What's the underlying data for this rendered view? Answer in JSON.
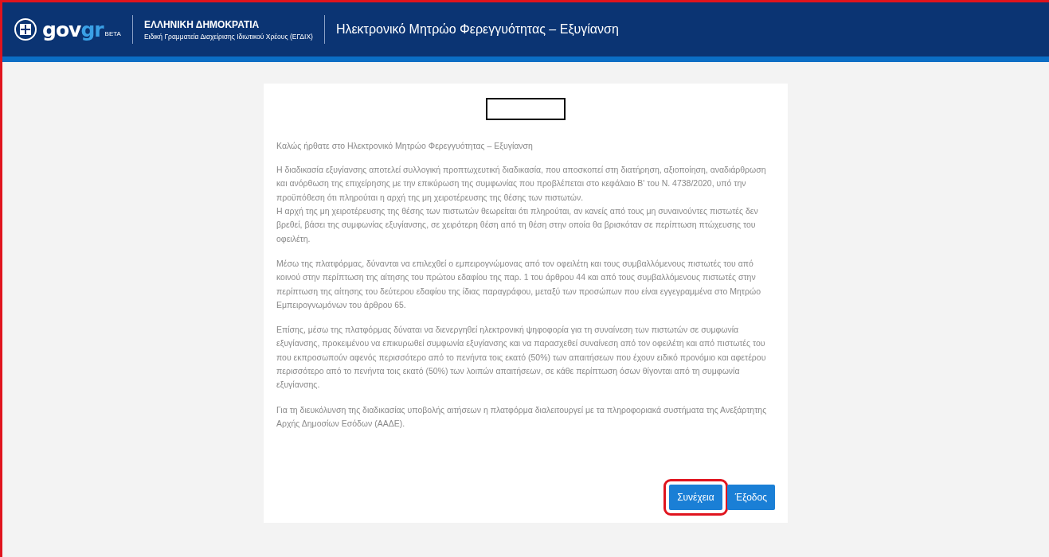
{
  "header": {
    "logo": {
      "gov": "gov",
      "gr": "gr",
      "badge": "BETA"
    },
    "organization": {
      "title": "ΕΛΛΗΝΙΚΗ ΔΗΜΟΚΡΑΤΙΑ",
      "subtitle": "Ειδική Γραμματεία Διαχείρισης Ιδιωτικού Χρέους (ΕΓΔΙΧ)"
    },
    "service_title": "Ηλεκτρονικό Μητρώο Φερεγγυότητας – Εξυγίανση"
  },
  "card": {
    "welcome": "Καλώς ήρθατε στο Ηλεκτρονικό Μητρώο Φερεγγυότητας – Εξυγίανση",
    "paragraphs": [
      {
        "lines": [
          "Η διαδικασία εξυγίανσης αποτελεί συλλογική προπτωχευτική διαδικασία, που αποσκοπεί στη διατήρηση, αξιοποίηση, αναδιάρθρωση και ανόρθωση της επιχείρησης με την επικύρωση της συμφωνίας που προβλέπεται στο κεφάλαιο Β' του Ν. 4738/2020, υπό την προϋπόθεση ότι πληρούται η αρχή της μη χειροτέρευσης της θέσης των πιστωτών.",
          "Η αρχή της μη χειροτέρευσης της θέσης των πιστωτών θεωρείται ότι πληρούται, αν κανείς από τους μη συναινούντες πιστωτές δεν βρεθεί, βάσει της συμφωνίας εξυγίανσης, σε χειρότερη θέση από τη θέση στην οποία θα βρισκόταν σε περίπτωση πτώχευσης του οφειλέτη."
        ]
      },
      {
        "lines": [
          "Μέσω της πλατφόρμας, δύνανται να επιλεχθεί ο εμπειρογνώμονας από τον οφειλέτη και τους συμβαλλόμενους πιστωτές του από κοινού στην περίπτωση της αίτησης του πρώτου εδαφίου της παρ. 1 του άρθρου 44 και από τους συμβαλλόμενους πιστωτές στην περίπτωση της αίτησης του δεύτερου εδαφίου της ίδιας παραγράφου, μεταξύ των προσώπων που είναι εγγεγραμμένα στο Μητρώο Εμπειρογνωμόνων του άρθρου 65."
        ]
      },
      {
        "lines": [
          "Επίσης, μέσω της πλατφόρμας δύναται να διενεργηθεί ηλεκτρονική ψηφοφορία για τη συναίνεση των πιστωτών σε συμφωνία εξυγίανσης, προκειμένου να επικυρωθεί συμφωνία εξυγίανσης και να παρασχεθεί συναίνεση από τον οφειλέτη και από πιστωτές του που εκπροσωπούν αφενός περισσότερο από το πενήντα τοις εκατό (50%) των απαιτήσεων που έχουν ειδικό προνόμιο και αφετέρου περισσότερο από το πενήντα τοις εκατό (50%) των λοιπών απαιτήσεων, σε κάθε περίπτωση όσων θίγονται από τη συμφωνία εξυγίανσης."
        ]
      },
      {
        "lines": [
          "Για τη διευκόλυνση της διαδικασίας υποβολής αιτήσεων η πλατφόρμα διαλειτουργεί με τα πληροφοριακά συστήματα της Ανεξάρτητης Αρχής Δημοσίων Εσόδων (ΑΑΔΕ)."
        ]
      }
    ],
    "buttons": [
      {
        "label": "Συνέχεια",
        "highlighted": true
      },
      {
        "label": "Έξοδος",
        "highlighted": false
      }
    ]
  }
}
